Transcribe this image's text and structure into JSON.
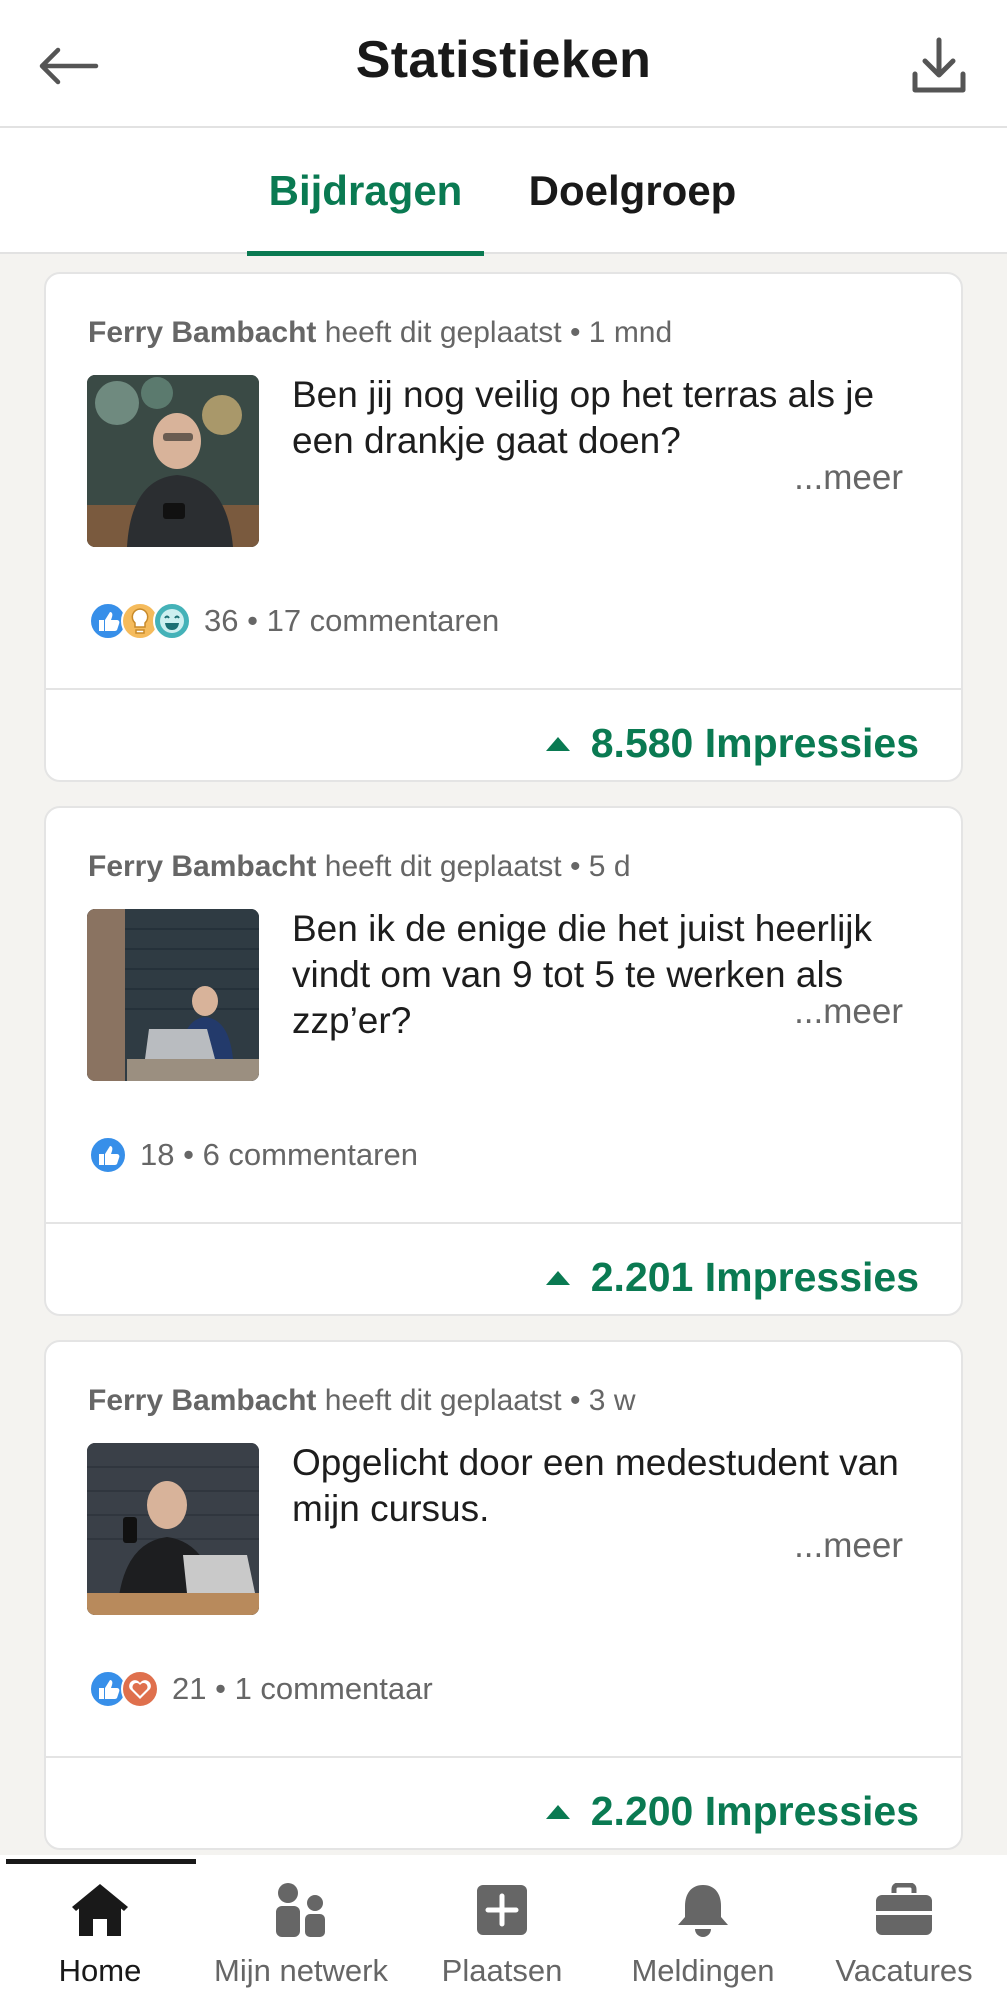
{
  "header": {
    "title": "Statistieken"
  },
  "tabs": [
    {
      "label": "Bijdragen",
      "active": true
    },
    {
      "label": "Doelgroep",
      "active": false
    }
  ],
  "posts": [
    {
      "author": "Ferry Bambacht",
      "action": "heeft dit geplaatst",
      "age": "1 mnd",
      "text": "Ben jij nog veilig op het terras als je een drankje gaat doen?",
      "more": "...meer",
      "reaction_icons": [
        "like-icon",
        "insightful-icon",
        "funny-icon"
      ],
      "reaction_count": "36",
      "comments": "17 commentaren",
      "impressions": "8.580 Impressies"
    },
    {
      "author": "Ferry Bambacht",
      "action": "heeft dit geplaatst",
      "age": "5 d",
      "text": "Ben ik de enige die het juist heerlijk vindt om van 9 tot 5 te werken als zzp’er?",
      "more": "...meer",
      "reaction_icons": [
        "like-icon"
      ],
      "reaction_count": "18",
      "comments": "6 commentaren",
      "impressions": "2.201 Impressies"
    },
    {
      "author": "Ferry Bambacht",
      "action": "heeft dit geplaatst",
      "age": "3 w",
      "text": "Opgelicht door een medestudent van mijn cursus.",
      "more": "...meer",
      "reaction_icons": [
        "like-icon",
        "love-icon"
      ],
      "reaction_count": "21",
      "comments": "1 commentaar",
      "impressions": "2.200 Impressies"
    }
  ],
  "nav": [
    {
      "label": "Home",
      "icon": "home-icon",
      "active": true
    },
    {
      "label": "Mijn netwerk",
      "icon": "network-icon",
      "active": false
    },
    {
      "label": "Plaatsen",
      "icon": "post-icon",
      "active": false
    },
    {
      "label": "Meldingen",
      "icon": "bell-icon",
      "active": false
    },
    {
      "label": "Vacatures",
      "icon": "briefcase-icon",
      "active": false
    }
  ],
  "colors": {
    "accent": "#0a7a52",
    "muted": "#666666",
    "like": "#378fe9",
    "love": "#df704d",
    "insightful": "#f5bb5c",
    "funny": "#44b2b8"
  }
}
